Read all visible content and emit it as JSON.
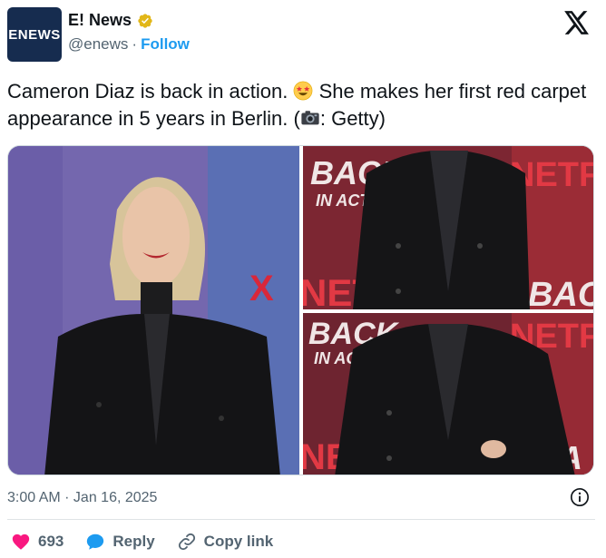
{
  "author": {
    "logo_text": "ENEWS",
    "name": "E! News",
    "handle": "@enews",
    "separator": "·",
    "follow_label": "Follow"
  },
  "tweet": {
    "text_part1": "Cameron Diaz is back in action. ",
    "text_part2": " She makes her first red carpet appearance in 5 years in Berlin. (",
    "text_part3": ": Getty)",
    "emoji_1": "star-struck-emoji",
    "emoji_2": "camera-emoji"
  },
  "media": {
    "photo_1_signage": "X",
    "photo_2_signage_left": "BACK",
    "photo_2_signage_sub": "IN ACT",
    "photo_2_signage_right": "NETF",
    "photo_2_signage_bottom_left": "NET",
    "photo_2_signage_bottom_right": "BAC",
    "photo_3_signage_left": "BACK",
    "photo_3_signage_sub": "IN ACT",
    "photo_3_signage_right": "NETF",
    "photo_3_signage_bottom_left": "NET",
    "photo_3_signage_bottom_right": "A"
  },
  "meta": {
    "timestamp": "3:00 AM · Jan 16, 2025"
  },
  "actions": {
    "likes": "693",
    "reply_label": "Reply",
    "copy_label": "Copy link"
  },
  "colors": {
    "accent": "#1d9bf0",
    "like": "#f91880",
    "verified_gold": "#e2b719",
    "muted": "#536471"
  }
}
